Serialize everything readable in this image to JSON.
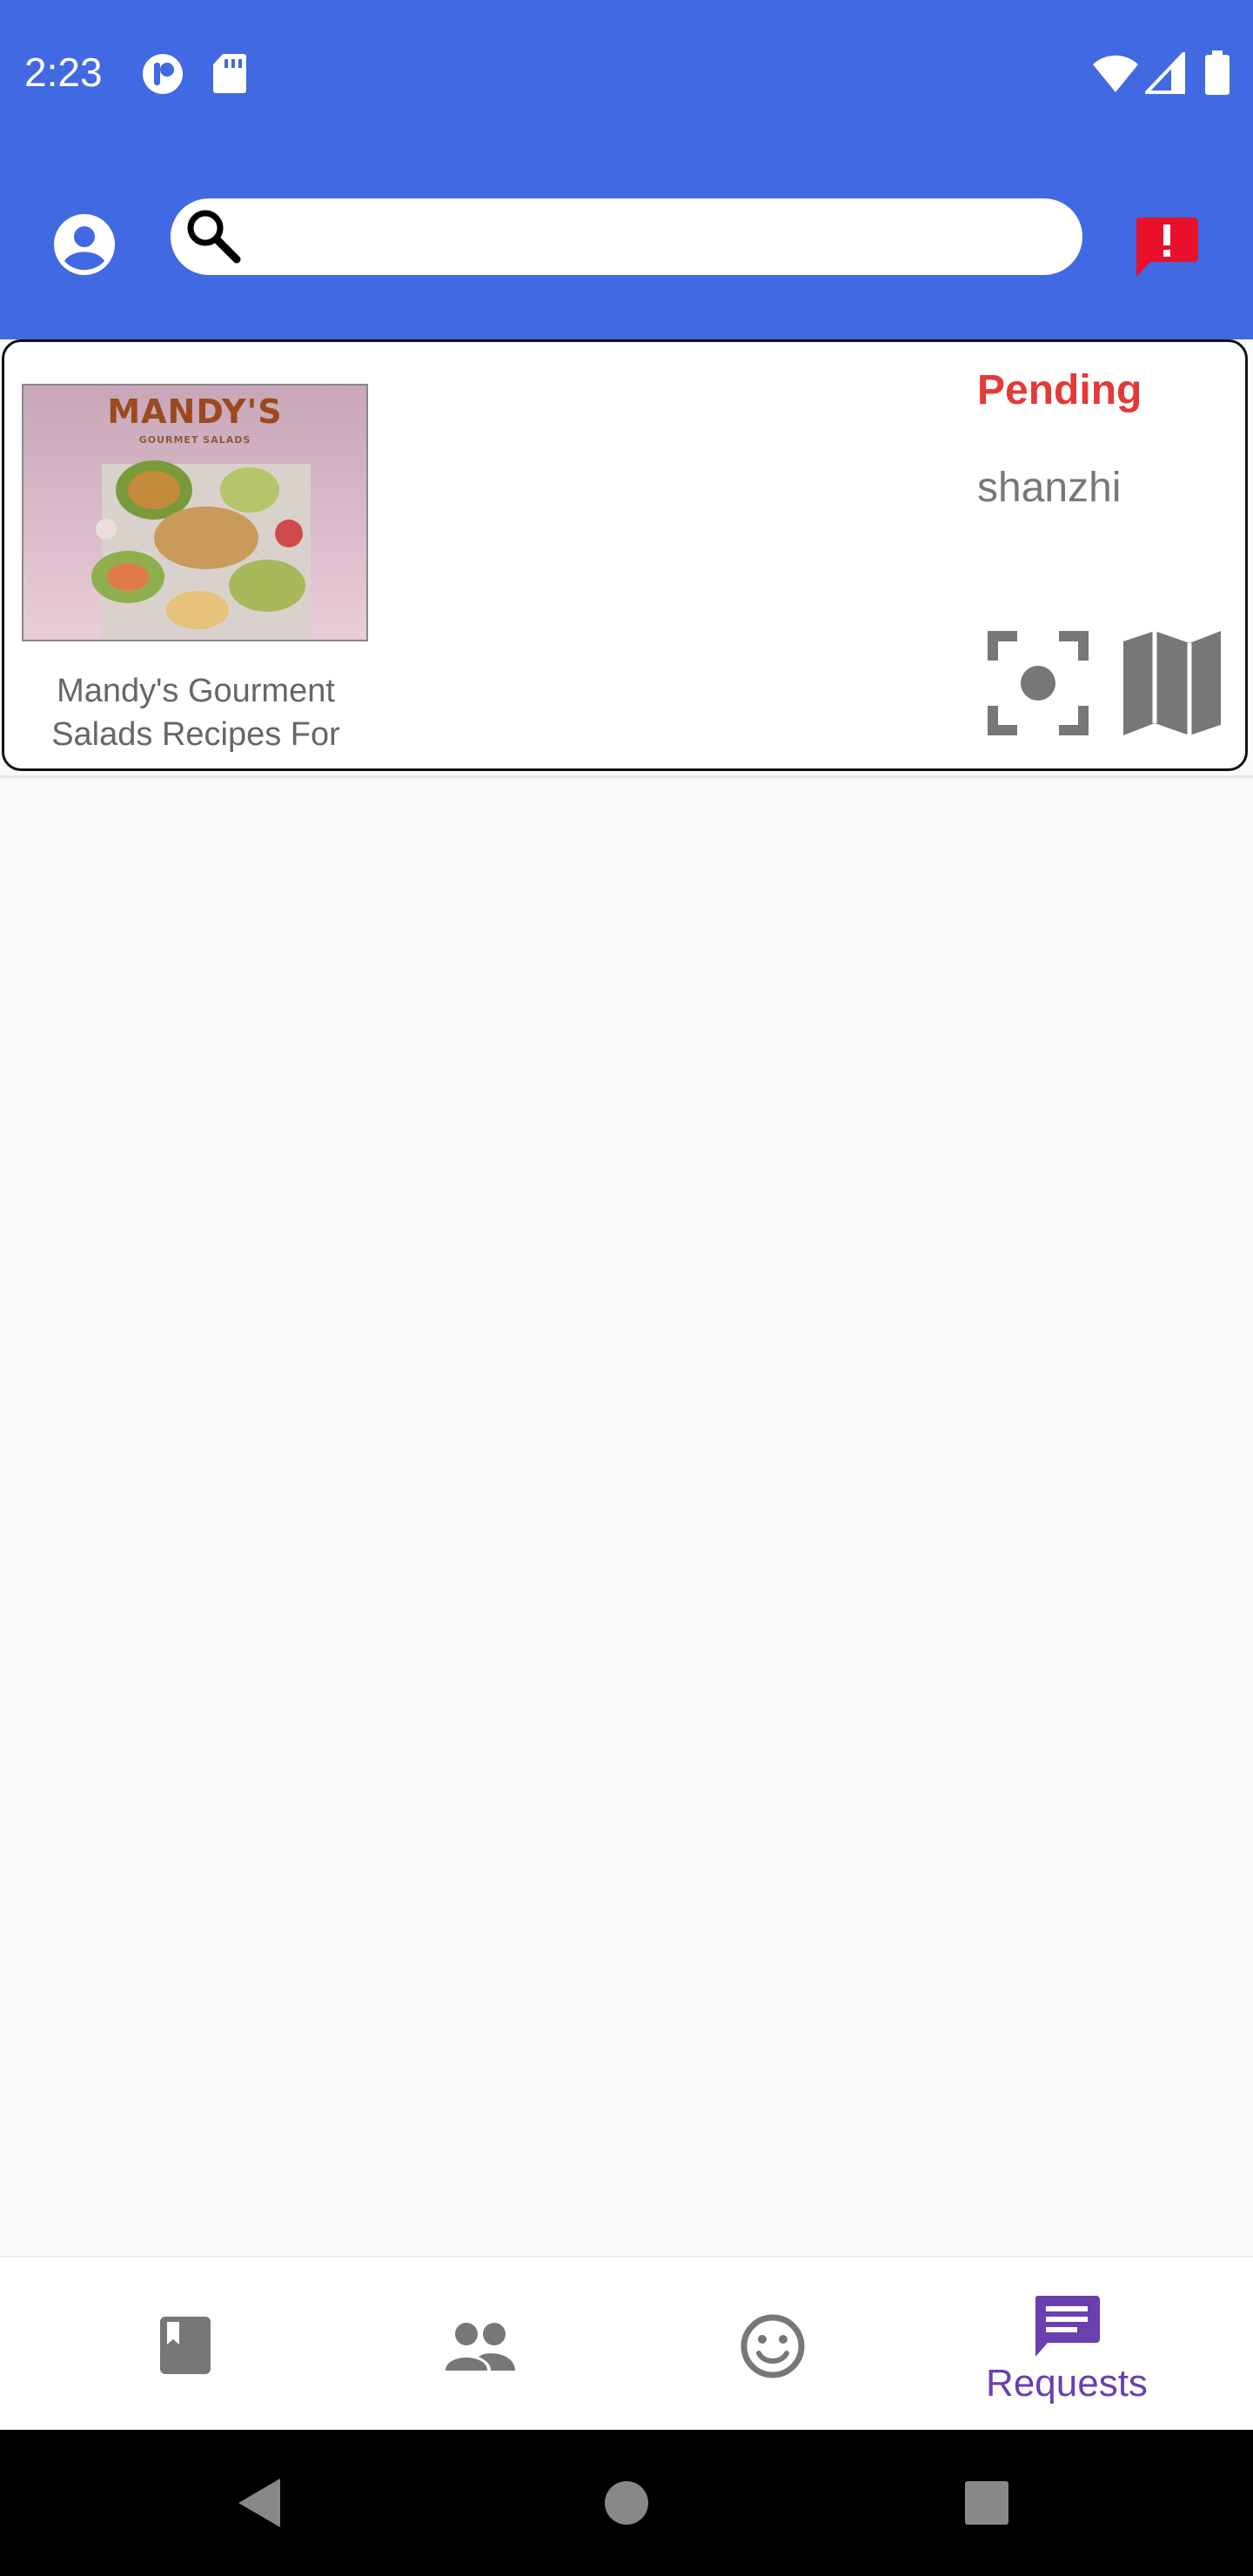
{
  "status_bar": {
    "time": "2:23"
  },
  "search": {
    "placeholder": ""
  },
  "card": {
    "cover_title": "MANDY'S",
    "cover_subtitle": "GOURMET SALADS",
    "book_title": "Mandy's Gourment Salads Recipes For",
    "status": "Pending",
    "owner": "shanzhi"
  },
  "bottom_nav": {
    "items": [
      {
        "icon": "book-icon",
        "label": ""
      },
      {
        "icon": "people-icon",
        "label": ""
      },
      {
        "icon": "smiley-icon",
        "label": ""
      },
      {
        "icon": "message-icon",
        "label": "Requests"
      }
    ]
  },
  "colors": {
    "primary": "#4169e1",
    "pending": "#e53935",
    "alert": "#e8102a",
    "nav_active": "#6a3fb0",
    "icon_gray": "#777777"
  }
}
